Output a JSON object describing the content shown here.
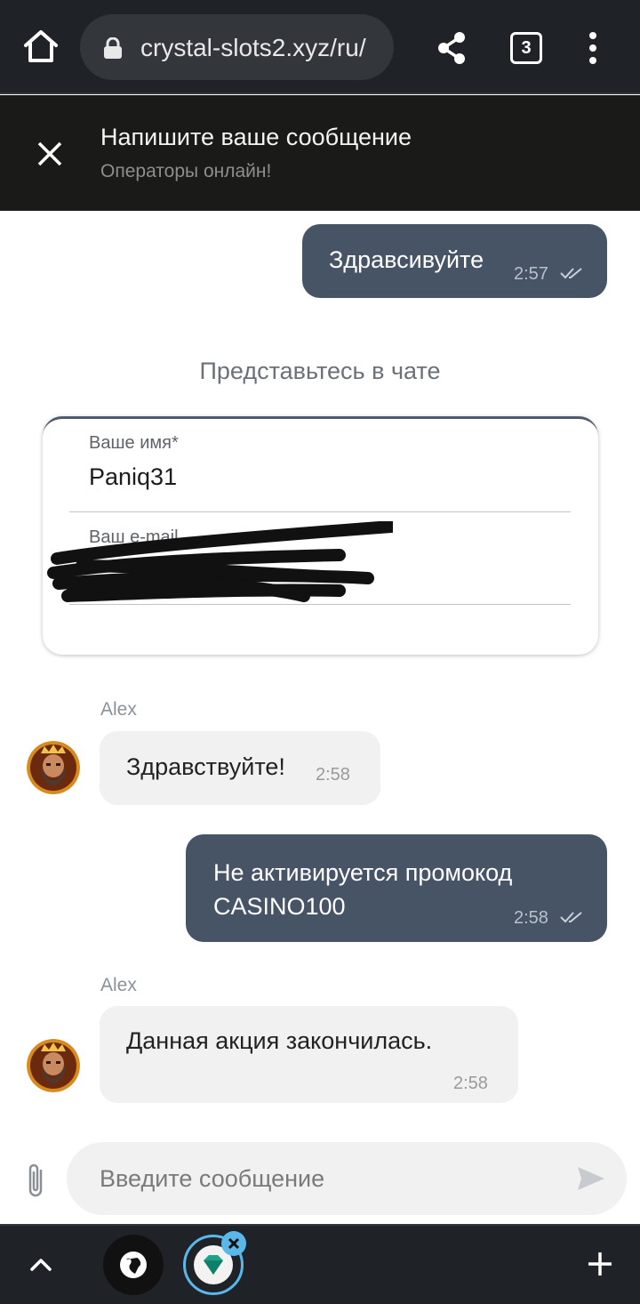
{
  "browser": {
    "url": "crystal-slots2.xyz/ru/",
    "tab_count": "3",
    "accent_color": "#5ab7ea"
  },
  "chat": {
    "title": "Напишите ваше сообщение",
    "subtitle": "Операторы онлайн!",
    "intro": "Представьтесь в чате",
    "form": {
      "name_label": "Ваше имя*",
      "name_value": "Paniq31",
      "email_label": "Ваш e-mail"
    },
    "messages": [
      {
        "direction": "outgoing",
        "text": "Здравсивуйте",
        "time": "2:57"
      },
      {
        "direction": "incoming",
        "sender": "Alex",
        "text": "Здравствуйте!",
        "time": "2:58"
      },
      {
        "direction": "outgoing",
        "text": "Не активируется промокод CASINO100",
        "time": "2:58"
      },
      {
        "direction": "incoming",
        "sender": "Alex",
        "text": "Данная акция закончилась.",
        "time": "2:58"
      }
    ],
    "input_placeholder": "Введите сообщение",
    "colors": {
      "outgoing_bubble": "#475466",
      "incoming_bubble": "#f1f1f1",
      "header_bg": "#1a1a18"
    }
  }
}
